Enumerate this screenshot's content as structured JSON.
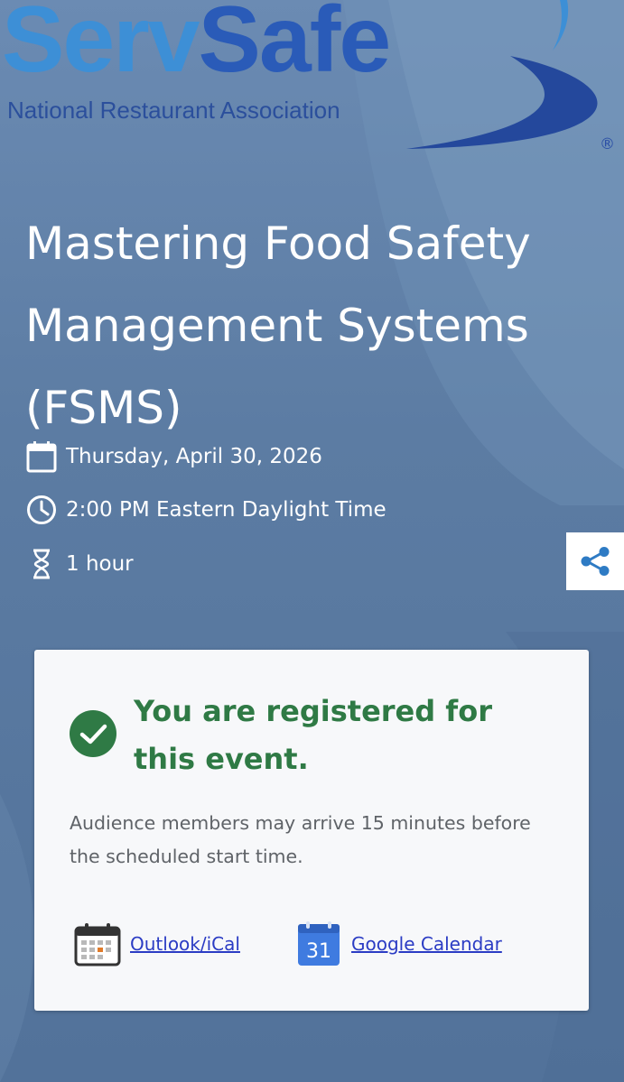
{
  "logo": {
    "word_part1": "Serv",
    "word_part2": "Safe",
    "subtitle": "National Restaurant Association",
    "registered_mark": "®"
  },
  "event": {
    "title": "Mastering Food Safety Management Systems (FSMS)",
    "date": "Thursday, April 30, 2026",
    "time": "2:00 PM Eastern Daylight Time",
    "duration": "1 hour"
  },
  "registration": {
    "status": "You are registered for this event.",
    "note": "Audience members may arrive 15 minutes before the scheduled start time.",
    "calendar_links": [
      {
        "label": "Outlook/iCal",
        "icon": "calendar-grid-icon"
      },
      {
        "label": "Google Calendar",
        "icon": "google-calendar-icon",
        "icon_text": "31"
      }
    ]
  },
  "icons": {
    "date": "calendar-icon",
    "time": "clock-icon",
    "duration": "hourglass-icon",
    "share": "share-icon",
    "status": "check-circle-icon"
  },
  "colors": {
    "background": "#5a7aa0",
    "logo_light_blue": "#3d8fd6",
    "logo_dark_blue": "#2a5bb8",
    "success_green": "#2f7a45",
    "link": "#2b3cc4",
    "share_icon": "#2e7bc4"
  }
}
